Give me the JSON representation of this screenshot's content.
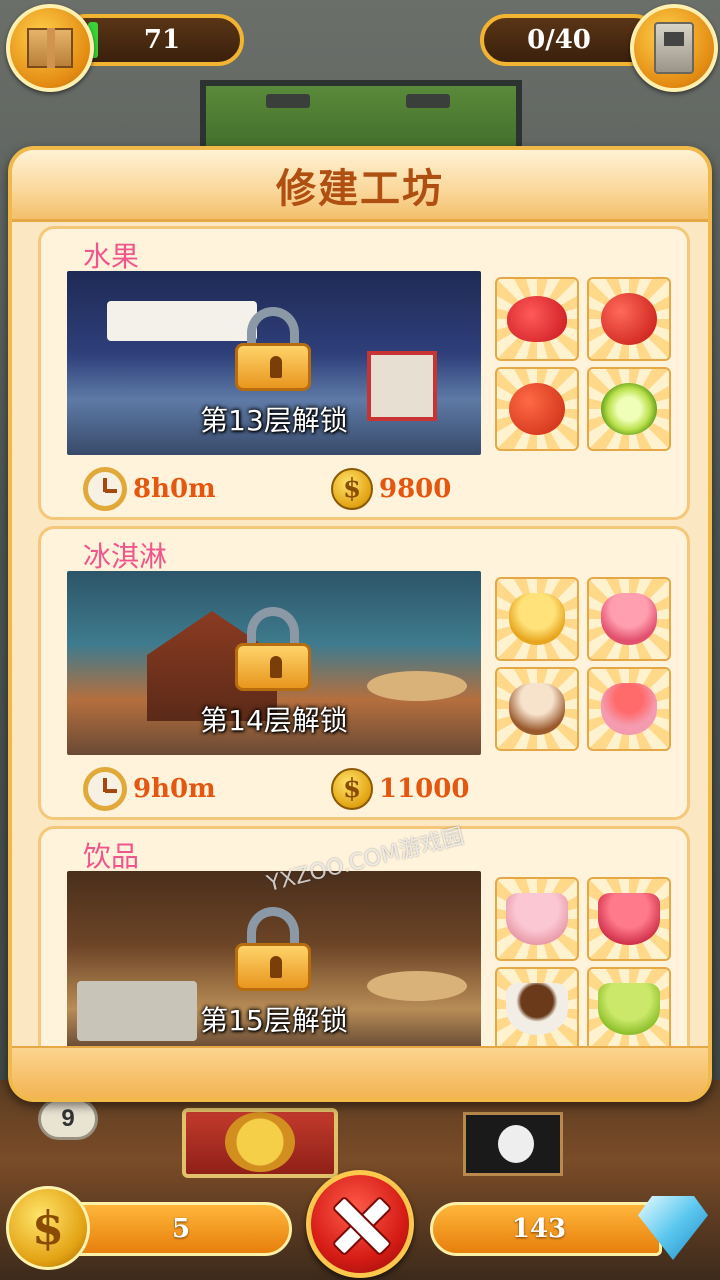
{
  "hud": {
    "box_count": "71",
    "capacity": "0/40",
    "coins": "5",
    "gems": "143"
  },
  "modal": {
    "title": "修建工坊"
  },
  "shops": [
    {
      "name": "水果",
      "unlock_text": "第13层解锁",
      "time": "8h0m",
      "cost": "9800",
      "recipes": [
        "strawberry",
        "apple",
        "tomato",
        "lime"
      ]
    },
    {
      "name": "冰淇淋",
      "unlock_text": "第14层解锁",
      "time": "9h0m",
      "cost": "11000",
      "recipes": [
        "mango-ice-cream",
        "cherry-ice-cream",
        "chocolate-ice-cream",
        "strawberry-ice-cream"
      ]
    },
    {
      "name": "饮品",
      "unlock_text": "第15层解锁",
      "recipes": [
        "strawberry-milk",
        "cherry-juice",
        "hot-chocolate",
        "lime-tea"
      ]
    }
  ],
  "scene": {
    "floor_number": "9"
  },
  "watermark": "YXZOO.COM游戏园",
  "icons": {
    "coin_symbol": "$"
  }
}
